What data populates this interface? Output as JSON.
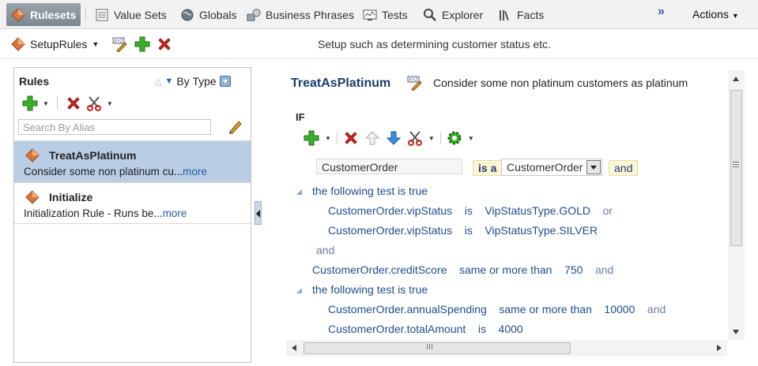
{
  "tabs": [
    {
      "label": "Rulesets",
      "icon": "ruleset-diamond-icon",
      "active": true
    },
    {
      "label": "Value Sets",
      "icon": "value-sets-icon"
    },
    {
      "label": "Globals",
      "icon": "globe-icon"
    },
    {
      "label": "Business Phrases",
      "icon": "business-phrases-icon"
    },
    {
      "label": "Tests",
      "icon": "tests-monitor-icon"
    },
    {
      "label": "Explorer",
      "icon": "search-icon"
    },
    {
      "label": "Facts",
      "icon": "facts-books-icon"
    }
  ],
  "overflow_chevron": "»",
  "actions_label": "Actions",
  "ruleset": {
    "name": "SetupRules",
    "description": "Setup such as determining customer status etc."
  },
  "rules_panel": {
    "title": "Rules",
    "sort_label": "By Type",
    "search_placeholder": "Search By Alias",
    "items": [
      {
        "name": "TreatAsPlatinum",
        "desc": "Consider some non platinum cu...",
        "more": "more",
        "selected": true
      },
      {
        "name": "Initialize",
        "desc": "Initialization Rule - Runs be...",
        "more": "more",
        "selected": false
      }
    ]
  },
  "editor": {
    "rule_name": "TreatAsPlatinum",
    "rule_desc": "Consider some non platinum customers as platinum",
    "if_label": "IF",
    "pattern": {
      "alias": "CustomerOrder",
      "is_a": "is a",
      "type": "CustomerOrder",
      "and": "and"
    },
    "lines": {
      "test1": "the following test is true",
      "c1": {
        "lhs": "CustomerOrder.vipStatus",
        "op": "is",
        "rhs": "VipStatusType.GOLD",
        "conj": "or"
      },
      "c2": {
        "lhs": "CustomerOrder.vipStatus",
        "op": "is",
        "rhs": "VipStatusType.SILVER"
      },
      "and1": "and",
      "c3": {
        "lhs": "CustomerOrder.creditScore",
        "op": "same or more than",
        "rhs": "750",
        "conj": "and"
      },
      "test2": "the following test is true",
      "c4": {
        "lhs": "CustomerOrder.annualSpending",
        "op": "same or more than",
        "rhs": "10000",
        "conj": "and"
      },
      "c5": {
        "lhs": "CustomerOrder.totalAmount",
        "op": "is",
        "rhs": "4000"
      }
    }
  }
}
